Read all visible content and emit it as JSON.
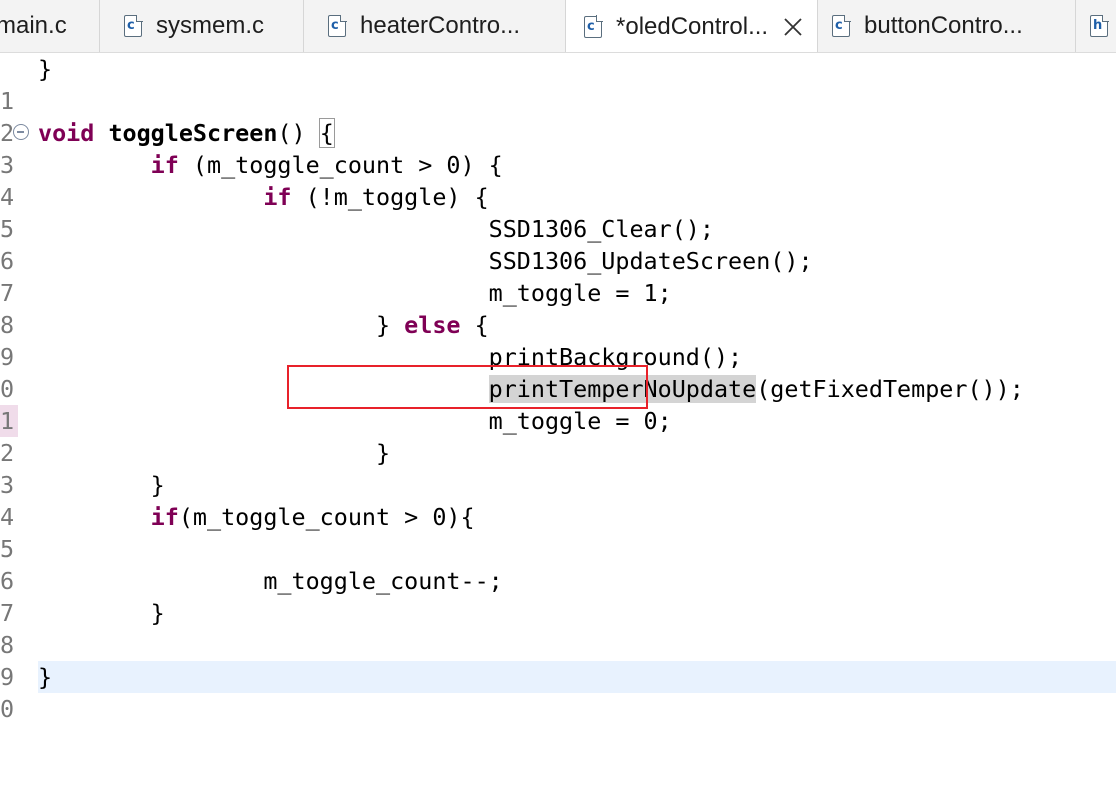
{
  "tabs": [
    {
      "label": "main.c",
      "icon": "c-file-icon"
    },
    {
      "label": "sysmem.c",
      "icon": "c-file-icon"
    },
    {
      "label": "heaterContro...",
      "icon": "c-file-icon"
    },
    {
      "label": "*oledControl...",
      "icon": "c-file-icon",
      "active": true
    },
    {
      "label": "buttonContro...",
      "icon": "c-file-icon"
    },
    {
      "label": "",
      "icon": "h-file-icon"
    }
  ],
  "icon_letters": {
    "c": "c",
    "h": "h"
  },
  "line_numbers": [
    "1",
    "2",
    "3",
    "4",
    "5",
    "6",
    "7",
    "8",
    "9",
    "0",
    "1",
    "2",
    "3",
    "4",
    "5",
    "6",
    "7",
    "8",
    "9",
    "0"
  ],
  "code": {
    "l1": "}",
    "l3_kw": "void",
    "l3_fn": "toggleScreen",
    "l3_rest": "() ",
    "l3_brace": "{",
    "l4_kw": "if",
    "l4_rest": " (m_toggle_count > 0) {",
    "l5_kw": "if",
    "l5_rest": " (!m_toggle) {",
    "l6": "SSD1306_Clear();",
    "l7": "SSD1306_UpdateScreen();",
    "l8": "m_toggle = 1;",
    "l9_pre": "} ",
    "l9_kw": "else",
    "l9_rest": " {",
    "l10": "printBackground();",
    "l11_hl": "printTemperNoUpdate",
    "l11_rest": "(getFixedTemper());",
    "l12": "m_toggle = 0;",
    "l13": "}",
    "l14": "}",
    "l15_kw": "if",
    "l15_rest": "(m_toggle_count > 0){",
    "l17": "m_toggle_count--;",
    "l18": "}",
    "l20": "}"
  }
}
